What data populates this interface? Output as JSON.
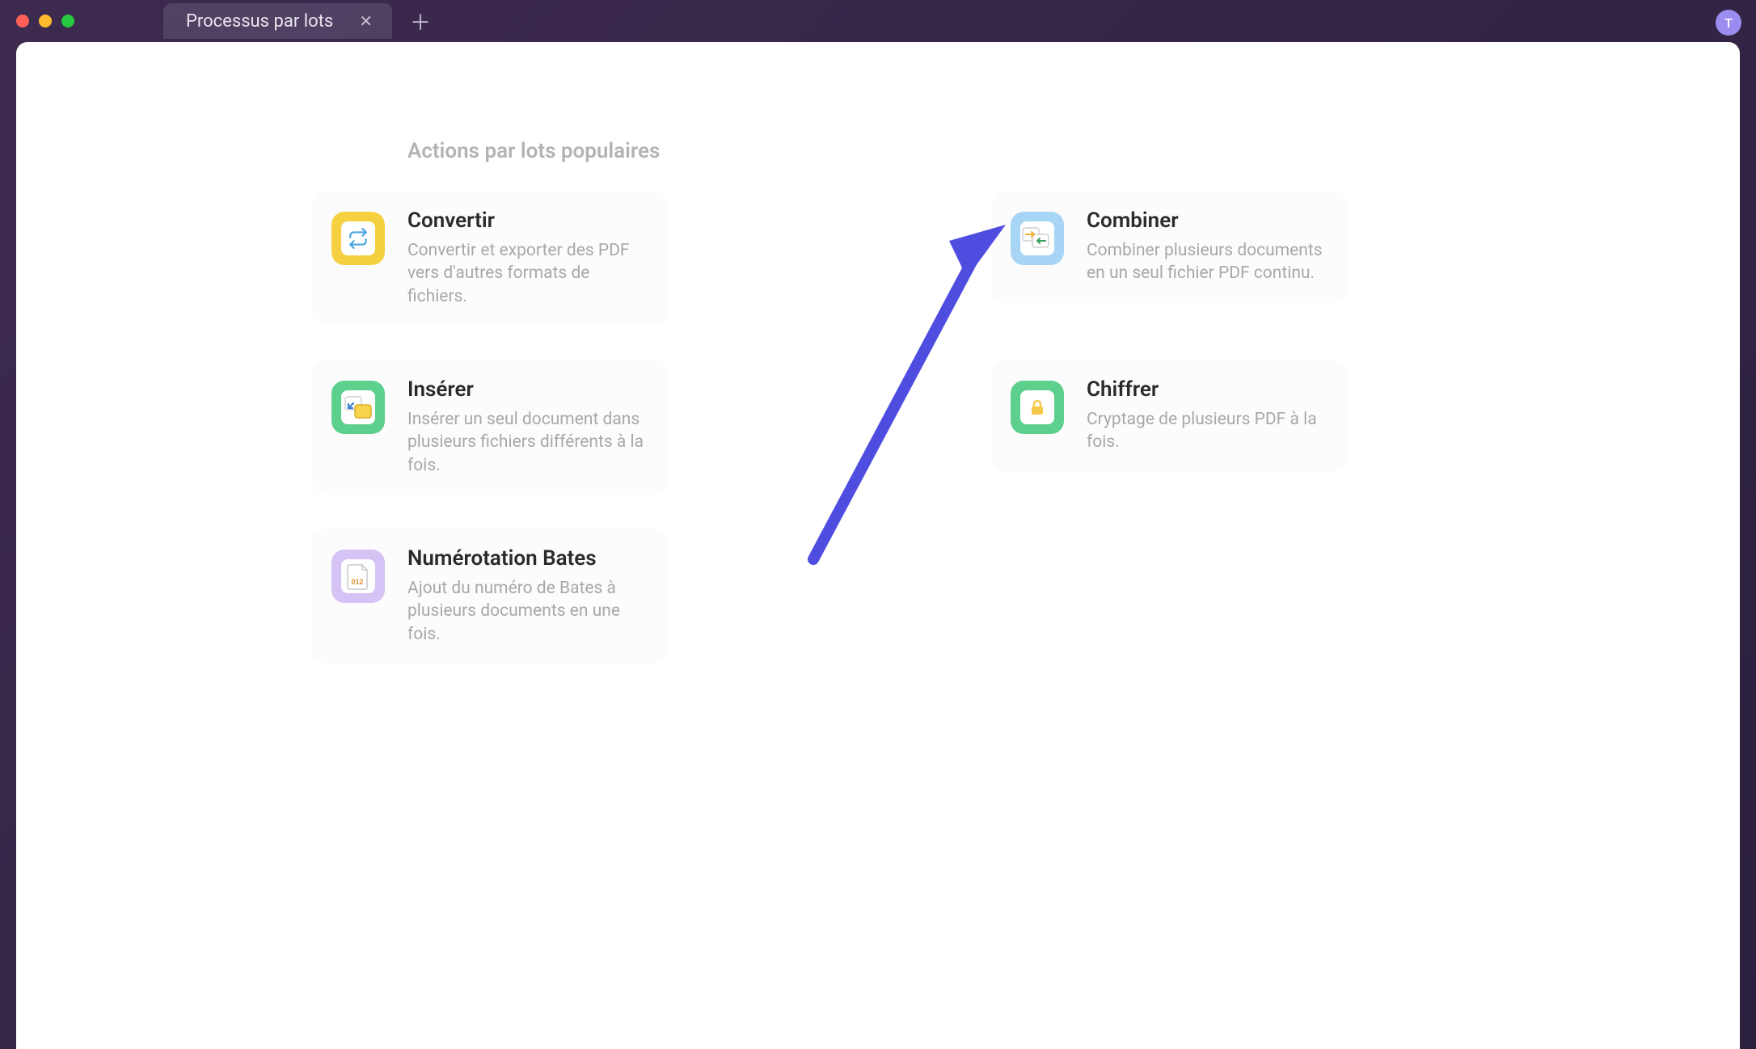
{
  "titlebar": {
    "tab_title": "Processus par lots",
    "avatar_initial": "T"
  },
  "section_title": "Actions par lots populaires",
  "cards": {
    "convert": {
      "title": "Convertir",
      "desc": "Convertir et exporter des PDF vers d'autres formats de fichiers.",
      "icon_bg": "#f5d041"
    },
    "combine": {
      "title": "Combiner",
      "desc": "Combiner plusieurs documents en un seul fichier PDF continu.",
      "icon_bg": "#a8d4f5"
    },
    "insert": {
      "title": "Insérer",
      "desc": "Insérer un seul document dans plusieurs fichiers différents à la fois.",
      "icon_bg": "#5dd08e"
    },
    "encrypt": {
      "title": "Chiffrer",
      "desc": "Cryptage de plusieurs PDF à la fois.",
      "icon_bg": "#5dd08e"
    },
    "bates": {
      "title": "Numérotation Bates",
      "desc": "Ajout du numéro de Bates à plusieurs documents en une fois.",
      "icon_bg": "#d5c3f5"
    }
  },
  "arrow_color": "#4f4de0"
}
